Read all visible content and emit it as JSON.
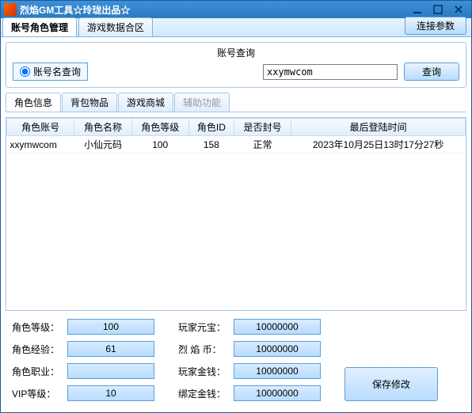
{
  "window": {
    "title": "烈焰GM工具☆玲珑出品☆"
  },
  "mainTabs": {
    "t0": "账号角色管理",
    "t1": "游戏数据合区",
    "link": "连接参数"
  },
  "query": {
    "title": "账号查询",
    "radioLabel": "账号名查询",
    "value": "xxymwcom",
    "btn": "查询"
  },
  "subTabs": {
    "t0": "角色信息",
    "t1": "背包物品",
    "t2": "游戏商城",
    "t3": "辅助功能"
  },
  "table": {
    "headers": {
      "c0": "角色账号",
      "c1": "角色名称",
      "c2": "角色等级",
      "c3": "角色ID",
      "c4": "是否封号",
      "c5": "最后登陆时间"
    },
    "row": {
      "c0": "xxymwcom",
      "c1": "小仙元码",
      "c2": "100",
      "c3": "158",
      "c4": "正常",
      "c5": "2023年10月25日13时17分27秒"
    }
  },
  "fields": {
    "left": {
      "l0": "角色等级：",
      "v0": "100",
      "l1": "角色经验：",
      "v1": "61",
      "l2": "角色职业：",
      "v2": "",
      "l3": "VIP等级：",
      "v3": "10"
    },
    "right": {
      "l0": "玩家元宝：",
      "v0": "10000000",
      "l1": "烈 焰 币：",
      "v1": "10000000",
      "l2": "玩家金钱：",
      "v2": "10000000",
      "l3": "绑定金钱：",
      "v3": "10000000"
    },
    "save": "保存修改"
  }
}
